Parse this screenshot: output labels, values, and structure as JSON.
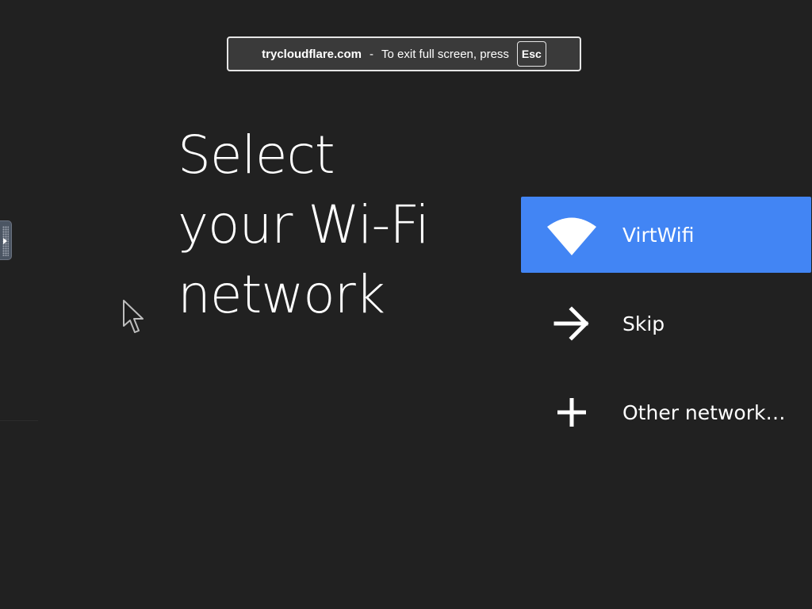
{
  "banner": {
    "domain": "trycloudflare.com",
    "separator": "-",
    "message": "To exit full screen, press",
    "key": "Esc"
  },
  "title": {
    "line1": "Select",
    "line2": "your Wi-Fi",
    "line3": "network"
  },
  "networks": [
    {
      "label": "VirtWifi",
      "icon": "wifi-icon",
      "selected": true
    },
    {
      "label": "Skip",
      "icon": "arrow-right-icon",
      "selected": false
    },
    {
      "label": "Other network…",
      "icon": "plus-icon",
      "selected": false
    }
  ],
  "colors": {
    "background": "#212121",
    "selected_item": "#4285f4",
    "text": "#ffffff"
  }
}
